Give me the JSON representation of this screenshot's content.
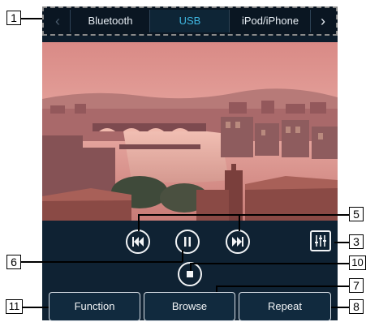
{
  "tabs": [
    {
      "label": "Bluetooth",
      "active": false
    },
    {
      "label": "USB",
      "active": true
    },
    {
      "label": "iPod/iPhone",
      "active": false
    }
  ],
  "nav": {
    "prev_icon": "chevron-left-icon",
    "next_icon": "chevron-right-icon"
  },
  "controls": {
    "previous_icon": "skip-previous-icon",
    "pause_icon": "pause-icon",
    "next_icon": "skip-next-icon",
    "stop_icon": "stop-icon",
    "sound_settings_icon": "equalizer-sliders-icon"
  },
  "buttons": {
    "function": "Function",
    "browse": "Browse",
    "repeat": "Repeat"
  },
  "callouts": {
    "c1": "1",
    "c3": "3",
    "c5": "5",
    "c6": "6",
    "c7": "7",
    "c8": "8",
    "c10": "10",
    "c11": "11"
  },
  "colors": {
    "accent": "#3fb6e0",
    "screen_bg": "#0d1d2c",
    "controls_bg": "#0f2233"
  }
}
